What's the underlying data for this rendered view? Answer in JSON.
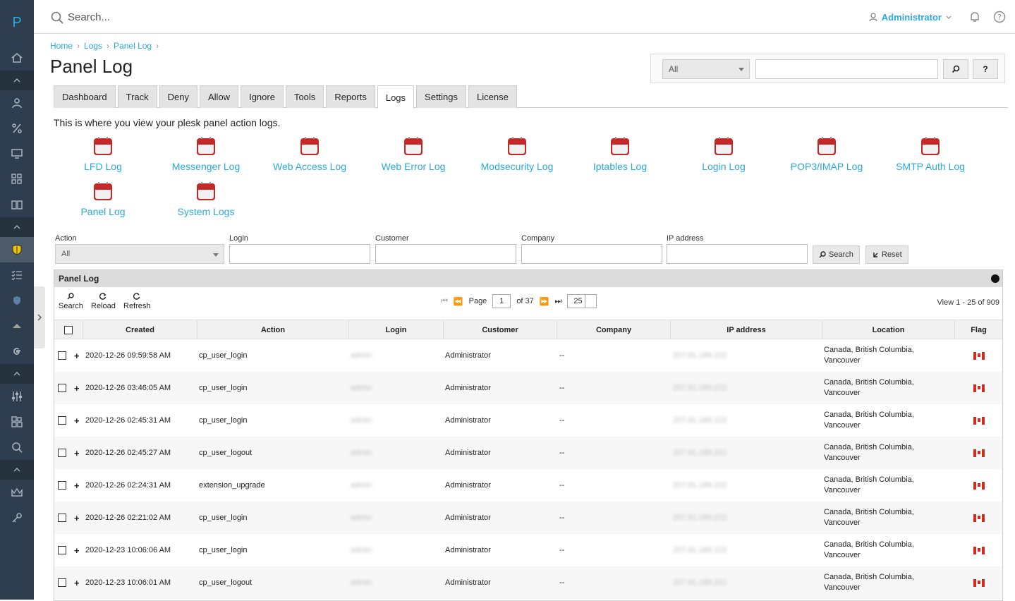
{
  "app": {
    "logo_letter": "P"
  },
  "topbar": {
    "search_placeholder": "Search...",
    "user": "Administrator"
  },
  "breadcrumb": [
    "Home",
    "Logs",
    "Panel Log"
  ],
  "page_title": "Panel Log",
  "top_filter": {
    "select_value": "All",
    "search_btn": "⌕",
    "help_btn": "?"
  },
  "tabs": [
    "Dashboard",
    "Track",
    "Deny",
    "Allow",
    "Ignore",
    "Tools",
    "Reports",
    "Logs",
    "Settings",
    "License"
  ],
  "active_tab": "Logs",
  "intro": "This is where you view your plesk panel action logs.",
  "log_links": [
    "LFD Log",
    "Messenger Log",
    "Web Access Log",
    "Web Error Log",
    "Modsecurity Log",
    "Iptables Log",
    "Login Log",
    "POP3/IMAP Log",
    "SMTP Auth Log",
    "Panel Log",
    "System Logs"
  ],
  "filters": {
    "action_label": "Action",
    "action_value": "All",
    "login_label": "Login",
    "customer_label": "Customer",
    "company_label": "Company",
    "ip_label": "IP address",
    "search_btn": "Search",
    "reset_btn": "Reset"
  },
  "grid": {
    "title": "Panel Log",
    "tools": [
      "Search",
      "Reload",
      "Refresh"
    ],
    "page_label": "Page",
    "page": "1",
    "of": "of 37",
    "per_page": "25",
    "view_info": "View 1 - 25 of 909",
    "columns": [
      "Created",
      "Action",
      "Login",
      "Customer",
      "Company",
      "IP address",
      "Location",
      "Flag"
    ],
    "rows": [
      {
        "created": "2020-12-26 09:59:58 AM",
        "action": "cp_user_login",
        "login": "admin",
        "customer": "Administrator",
        "company": "--",
        "ip": "207.81.189.222",
        "loc1": "Canada, British Columbia,",
        "loc2": "Vancouver"
      },
      {
        "created": "2020-12-26 03:46:05 AM",
        "action": "cp_user_login",
        "login": "admin",
        "customer": "Administrator",
        "company": "--",
        "ip": "207.81.189.222",
        "loc1": "Canada, British Columbia,",
        "loc2": "Vancouver"
      },
      {
        "created": "2020-12-26 02:45:31 AM",
        "action": "cp_user_login",
        "login": "admin",
        "customer": "Administrator",
        "company": "--",
        "ip": "207.81.189.222",
        "loc1": "Canada, British Columbia,",
        "loc2": "Vancouver"
      },
      {
        "created": "2020-12-26 02:45:27 AM",
        "action": "cp_user_logout",
        "login": "admin",
        "customer": "Administrator",
        "company": "--",
        "ip": "207.81.189.222",
        "loc1": "Canada, British Columbia,",
        "loc2": "Vancouver"
      },
      {
        "created": "2020-12-26 02:24:31 AM",
        "action": "extension_upgrade",
        "login": "admin",
        "customer": "Administrator",
        "company": "--",
        "ip": "207.81.189.222",
        "loc1": "Canada, British Columbia,",
        "loc2": "Vancouver"
      },
      {
        "created": "2020-12-26 02:21:02 AM",
        "action": "cp_user_login",
        "login": "admin",
        "customer": "Administrator",
        "company": "--",
        "ip": "207.81.189.222",
        "loc1": "Canada, British Columbia,",
        "loc2": "Vancouver"
      },
      {
        "created": "2020-12-23 10:06:06 AM",
        "action": "cp_user_login",
        "login": "admin",
        "customer": "Administrator",
        "company": "--",
        "ip": "207.81.189.222",
        "loc1": "Canada, British Columbia,",
        "loc2": "Vancouver"
      },
      {
        "created": "2020-12-23 10:06:01 AM",
        "action": "cp_user_logout",
        "login": "admin",
        "customer": "Administrator",
        "company": "--",
        "ip": "207.81.189.222",
        "loc1": "Canada, British Columbia,",
        "loc2": "Vancouver"
      }
    ]
  }
}
